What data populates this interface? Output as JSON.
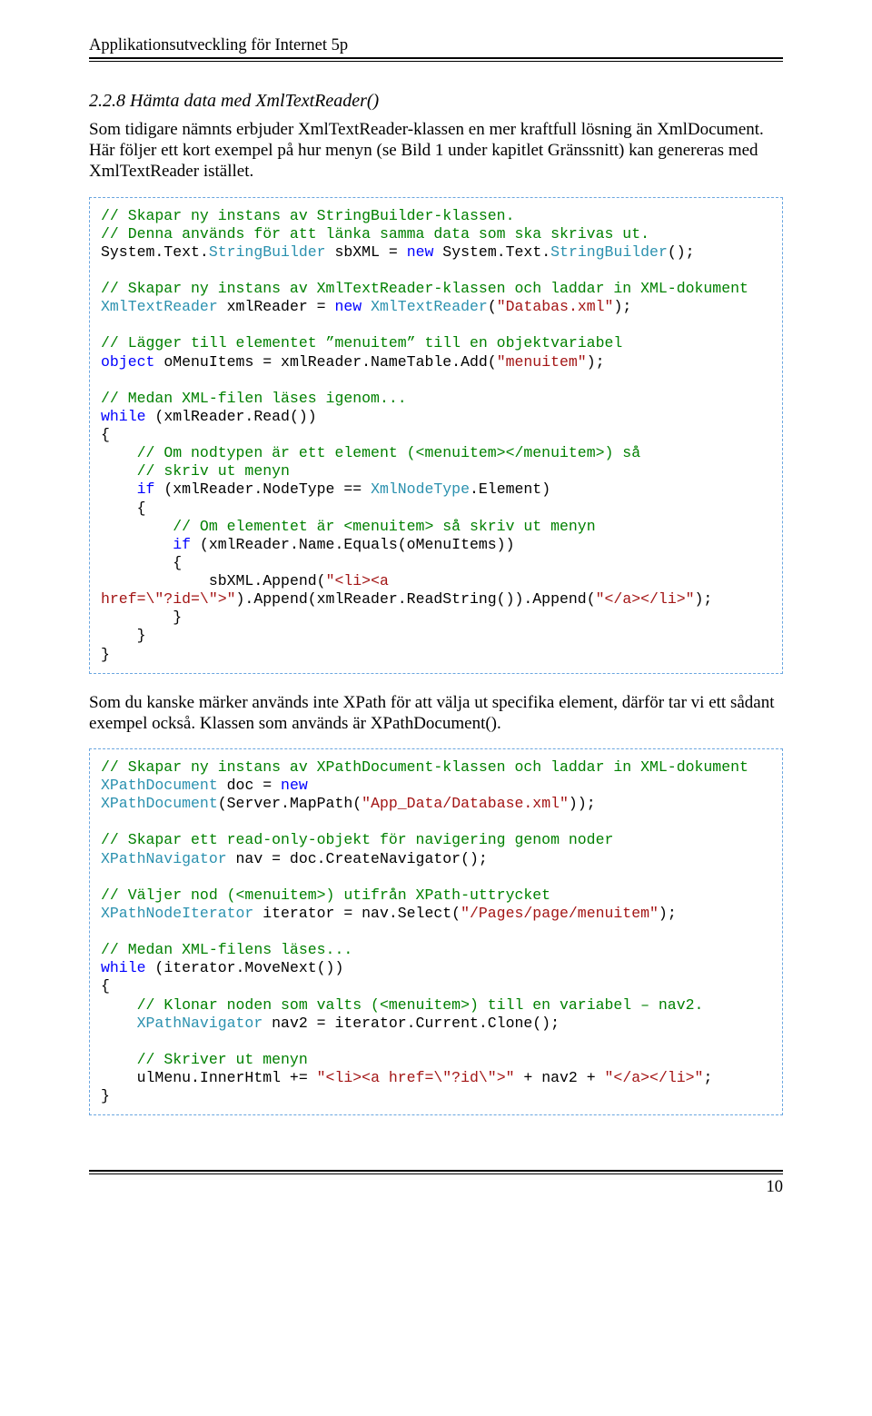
{
  "header": {
    "title": "Applikationsutveckling för Internet 5p"
  },
  "section": {
    "heading": "2.2.8  Hämta data med XmlTextReader()"
  },
  "para1": "Som tidigare nämnts erbjuder XmlTextReader-klassen en mer kraftfull lösning än XmlDocument. Här följer ett kort exempel på hur menyn (se Bild 1 under kapitlet Gränssnitt) kan genereras med XmlTextReader istället.",
  "code1": {
    "l01a": "// Skapar ny instans av StringBuilder-klassen.",
    "l01b": "// Denna används för att länka samma data som ska skrivas ut.",
    "l02a": "System.Text.",
    "l02b": "StringBuilder",
    "l02c": " sbXML = ",
    "l02d": "new",
    "l02e": " System.Text.",
    "l02f": "StringBuilder",
    "l02g": "();",
    "l03a": "// Skapar ny instans av XmlTextReader-klassen och laddar in XML-dokument",
    "l04a": "XmlTextReader",
    "l04b": " xmlReader = ",
    "l04c": "new",
    "l04d": " ",
    "l04e": "XmlTextReader",
    "l04f": "(",
    "l04g": "\"Databas.xml\"",
    "l04h": ");",
    "l05a": "// Lägger till elementet ”menuitem” till en objektvariabel",
    "l06a": "object",
    "l06b": " oMenuItems = xmlReader.NameTable.Add(",
    "l06c": "\"menuitem\"",
    "l06d": ");",
    "l07a": "// Medan XML-filen läses igenom...",
    "l08a": "while",
    "l08b": " (xmlReader.Read())",
    "l09a": "{",
    "l10a": "    ",
    "l10b": "// Om nodtypen är ett element (<menuitem></menuitem>) så",
    "l10c": "    ",
    "l10d": "// skriv ut menyn",
    "l11a": "    ",
    "l11b": "if",
    "l11c": " (xmlReader.NodeType == ",
    "l11d": "XmlNodeType",
    "l11e": ".Element)",
    "l12a": "    {",
    "l13a": "        ",
    "l13b": "// Om elementet är <menuitem> så skriv ut menyn",
    "l14a": "        ",
    "l14b": "if",
    "l14c": " (xmlReader.Name.Equals(oMenuItems))",
    "l15a": "        {",
    "l16a": "            sbXML.Append(",
    "l16b": "\"<li><a ",
    "l16c": "href=\\\"?id=\\\">\"",
    "l16d": ").Append(xmlReader.ReadString()).Append(",
    "l16e": "\"</a></li>\"",
    "l16f": ");",
    "l17a": "        }",
    "l18a": "    }",
    "l19a": "}"
  },
  "para2": "Som du kanske märker används inte XPath för att välja ut specifika element, därför tar vi ett sådant exempel också. Klassen som används är XPathDocument().",
  "code2": {
    "l01a": "// Skapar ny instans av XPathDocument-klassen och laddar in XML-dokument",
    "l02a": "XPathDocument",
    "l02b": " doc = ",
    "l02c": "new",
    "l03a": "XPathDocument",
    "l03b": "(Server.MapPath(",
    "l03c": "\"App_Data/Database.xml\"",
    "l03d": "));",
    "l04a": "// Skapar ett read-only-objekt för navigering genom noder",
    "l05a": "XPathNavigator",
    "l05b": " nav = doc.CreateNavigator();",
    "l06a": "// Väljer nod (<menuitem>) utifrån XPath-uttrycket",
    "l07a": "XPathNodeIterator",
    "l07b": " iterator = nav.Select(",
    "l07c": "\"/Pages/page/menuitem\"",
    "l07d": ");",
    "l08a": "// Medan XML-filens läses...",
    "l09a": "while",
    "l09b": " (iterator.MoveNext())",
    "l10a": "{",
    "l11a": "    ",
    "l11b": "// Klonar noden som valts (<menuitem>) till en variabel – nav2.",
    "l12a": "    ",
    "l12b": "XPathNavigator",
    "l12c": " nav2 = iterator.Current.Clone();",
    "l13a": "    ",
    "l13b": "// Skriver ut menyn",
    "l14a": "    ulMenu.InnerHtml += ",
    "l14b": "\"<li><a href=\\\"?id\\\">\"",
    "l14c": " + nav2 + ",
    "l14d": "\"</a></li>\"",
    "l14e": ";",
    "l15a": "}"
  },
  "footer": {
    "page_number": "10"
  }
}
